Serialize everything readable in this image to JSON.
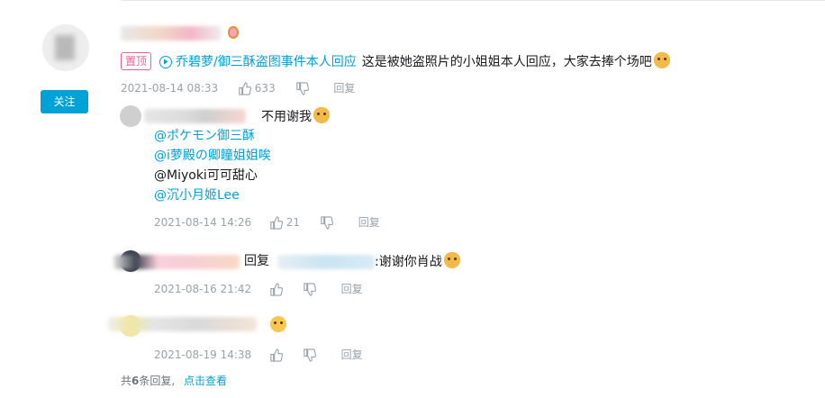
{
  "colors": {
    "accent": "#00a1d6",
    "pin": "#f25d8e",
    "meta": "#99a2aa"
  },
  "main_comment": {
    "follow_label": "关注",
    "pin_label": "置顶",
    "video_link": "乔碧萝/御三酥盗图事件本人回应",
    "text": "这是被她盗照片的小姐姐本人回应，大家去捧个场吧",
    "date": "2021-08-14 08:33",
    "likes": "633",
    "reply_label": "回复"
  },
  "replies": [
    {
      "text": "不用谢我",
      "mentions": [
        "@ポケモン御三酥",
        "@i萝殿の卿瞳姐姐唉",
        "@Miyoki可可甜心",
        "@沉小月姬Lee"
      ],
      "date": "2021-08-14 14:26",
      "likes": "21",
      "reply_label": "回复"
    },
    {
      "prefix": "回复",
      "text": ":谢谢你肖战",
      "date": "2021-08-16 21:42",
      "reply_label": "回复"
    },
    {
      "date": "2021-08-19 14:38",
      "reply_label": "回复"
    }
  ],
  "footer": {
    "prefix": "共",
    "count": "6",
    "suffix": "条回复,",
    "link": "点击查看"
  },
  "icons": [
    "thumb-up-icon",
    "thumb-down-icon",
    "play-circle-icon",
    "medal-icon",
    "cat-emoji-icon",
    "smile-emoji-icon"
  ]
}
